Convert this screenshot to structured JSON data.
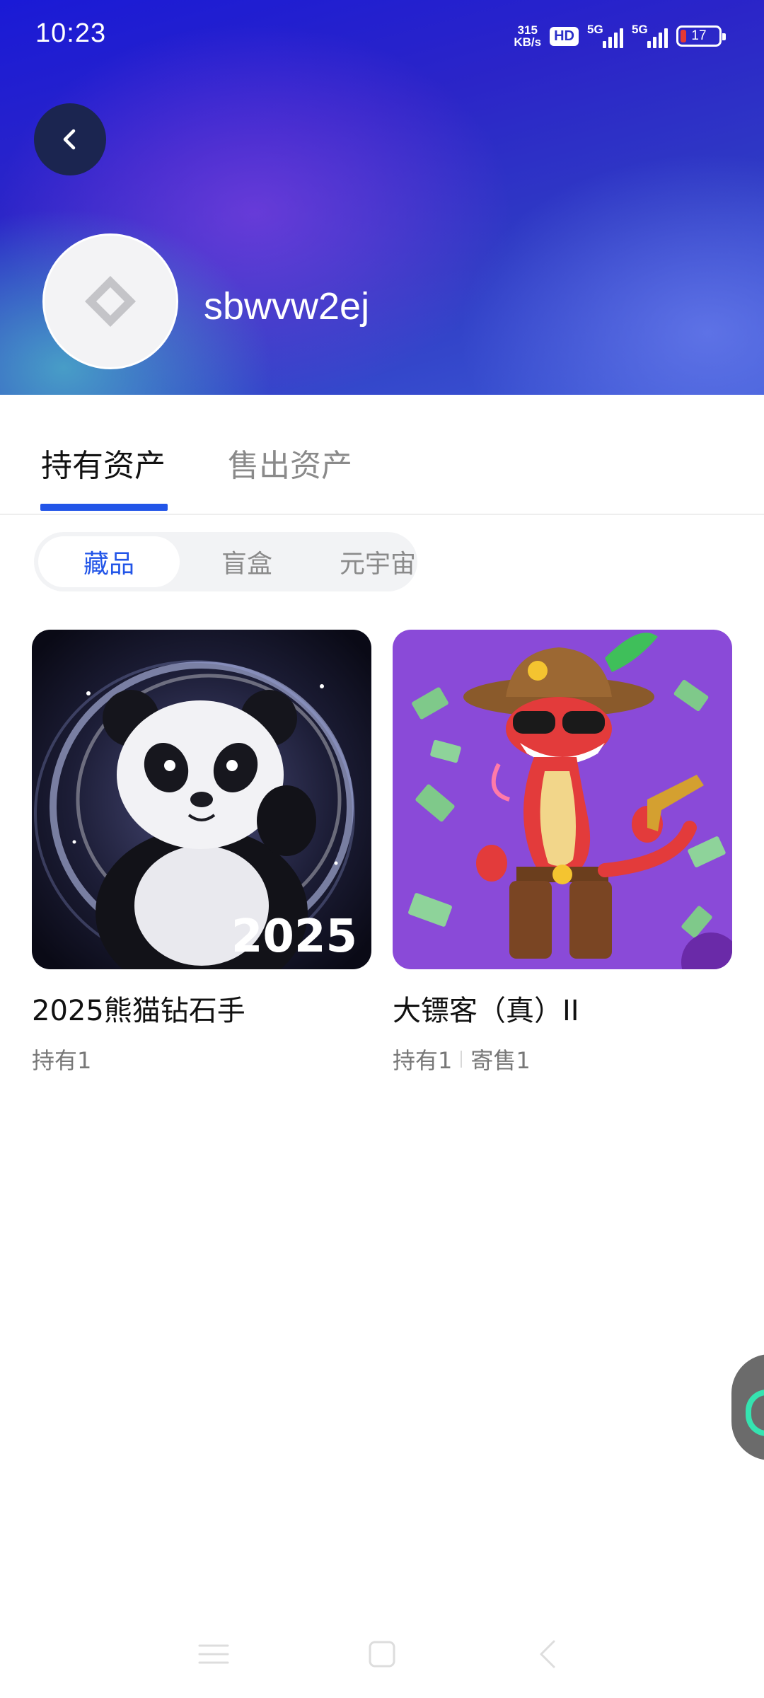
{
  "status_bar": {
    "time": "10:23",
    "net_speed_value": "315",
    "net_speed_unit": "KB/s",
    "hd_badge": "HD",
    "signal1_label": "5G",
    "signal2_label": "5G",
    "battery_level": "17",
    "battery_color": "#e53935"
  },
  "header": {
    "back_icon": "chevron-left-icon",
    "avatar_icon": "diamond-logo-icon",
    "username": "sbwvw2ej",
    "gradient_colors": [
      "#1a1ad6",
      "#2f3bc4",
      "#3b57d4"
    ]
  },
  "tabs": {
    "items": [
      {
        "label": "持有资产",
        "active": true
      },
      {
        "label": "售出资产",
        "active": false
      }
    ],
    "indicator_color": "#2255e8"
  },
  "segments": {
    "items": [
      {
        "label": "藏品",
        "active": true
      },
      {
        "label": "盲盒",
        "active": false
      },
      {
        "label": "元宇宙",
        "active": false
      }
    ]
  },
  "cards": [
    {
      "title": "2025熊猫钻石手",
      "hold": "持有1",
      "image_text": "2025",
      "image_desc": "panda-artwork"
    },
    {
      "title": "大镖客（真）II",
      "hold": "持有1",
      "consign": "寄售1",
      "image_desc": "cowboy-snake-artwork"
    }
  ],
  "accent_color": "#2255e8",
  "nav_bar": {
    "icons": [
      "menu-icon",
      "home-icon",
      "back-icon"
    ]
  }
}
